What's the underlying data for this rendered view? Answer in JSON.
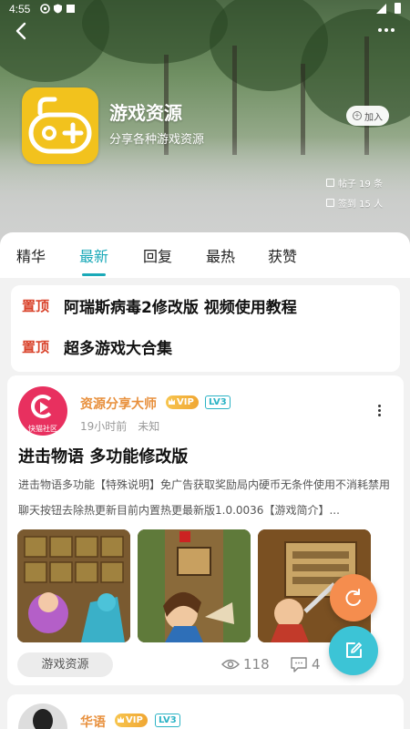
{
  "status_bar": {
    "time": "4:55"
  },
  "group": {
    "name": "游戏资源",
    "description": "分享各种游戏资源",
    "join_label": "加入",
    "posts_stat": "帖子 19 条",
    "signin_stat": "签到 15 人"
  },
  "tabs": [
    {
      "label": "精华",
      "active": false
    },
    {
      "label": "最新",
      "active": true
    },
    {
      "label": "回复",
      "active": false
    },
    {
      "label": "最热",
      "active": false
    },
    {
      "label": "获赞",
      "active": false
    }
  ],
  "pinned": [
    {
      "badge": "置顶",
      "title": "阿瑞斯病毒2修改版 视频使用教程"
    },
    {
      "badge": "置顶",
      "title": "超多游戏大合集"
    }
  ],
  "post": {
    "author": "资源分享大师",
    "vip_label": "VIP",
    "level_label": "LV3",
    "time": "19小时前",
    "location": "未知",
    "avatar_caption": "快猫社区",
    "title": "进击物语 多功能修改版",
    "body": "进击物语多功能【特殊说明】免广告获取奖励局内硬币无条件使用不消耗禁用聊天按钮去除热更新目前内置热更最新版1.0.0036【游戏简介】...",
    "tag": "游戏资源",
    "views": "118",
    "comments": "4"
  },
  "post2": {
    "author": "华语",
    "vip_label": "VIP",
    "level_label": "LV3"
  },
  "colors": {
    "accent": "#1aa9b8",
    "pin_red": "#d9432b",
    "author_orange": "#e8903d",
    "fab_orange": "#f58d4e",
    "fab_teal": "#3cc4d6",
    "logo_yellow": "#f2c21d"
  },
  "icons": {
    "back": "back-arrow-icon",
    "more": "more-dots-icon",
    "refresh": "refresh-icon",
    "write": "edit-icon",
    "views": "eye-icon",
    "comments": "comment-icon"
  }
}
